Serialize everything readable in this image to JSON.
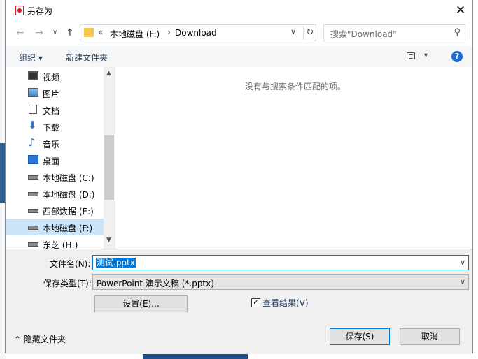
{
  "dialog": {
    "title": "另存为",
    "close_glyph": "✕"
  },
  "nav": {
    "back_glyph": "←",
    "forward_glyph": "→",
    "history_glyph": "∨",
    "up_glyph": "↑",
    "address": {
      "chevrons": "«",
      "segments": [
        "本地磁盘 (F:)",
        "Download"
      ],
      "separator": "›",
      "dropdown_glyph": "∨",
      "refresh_glyph": "↻"
    },
    "search_placeholder": "搜索\"Download\"",
    "search_glyph": "⚲"
  },
  "toolbar": {
    "organize": "组织 ▾",
    "new_folder": "新建文件夹",
    "view_dd_glyph": "▾",
    "help_glyph": "?"
  },
  "sidebar": {
    "items": [
      {
        "label": "视频",
        "icon": "video-icon"
      },
      {
        "label": "图片",
        "icon": "pictures-icon"
      },
      {
        "label": "文档",
        "icon": "documents-icon"
      },
      {
        "label": "下载",
        "icon": "downloads-icon"
      },
      {
        "label": "音乐",
        "icon": "music-icon"
      },
      {
        "label": "桌面",
        "icon": "desktop-icon"
      },
      {
        "label": "本地磁盘 (C:)",
        "icon": "system-drive-icon"
      },
      {
        "label": "本地磁盘 (D:)",
        "icon": "drive-icon"
      },
      {
        "label": "西部数据 (E:)",
        "icon": "drive-icon"
      },
      {
        "label": "本地磁盘 (F:)",
        "icon": "drive-icon",
        "selected": true
      },
      {
        "label": "东芝 (H:)",
        "icon": "drive-icon"
      }
    ],
    "scroll_up_glyph": "▲",
    "scroll_down_glyph": "▼"
  },
  "content": {
    "empty_message": "没有与搜索条件匹配的项。"
  },
  "form": {
    "filename_label": "文件名(N):",
    "filename_value": "测试.pptx",
    "filetype_label": "保存类型(T):",
    "filetype_value": "PowerPoint 演示文稿 (*.pptx)",
    "dropdown_glyph": "∨",
    "settings_button": "设置(E)...",
    "view_results_label": "查看结果(V)",
    "view_results_checked": true,
    "check_glyph": "✓",
    "hide_folders": "⌃ 隐藏文件夹",
    "save_button": "保存(S)",
    "cancel_button": "取消"
  },
  "colors": {
    "accent": "#0078d7",
    "selected_bg": "#cce4f7",
    "help": "#1e6fd1"
  }
}
